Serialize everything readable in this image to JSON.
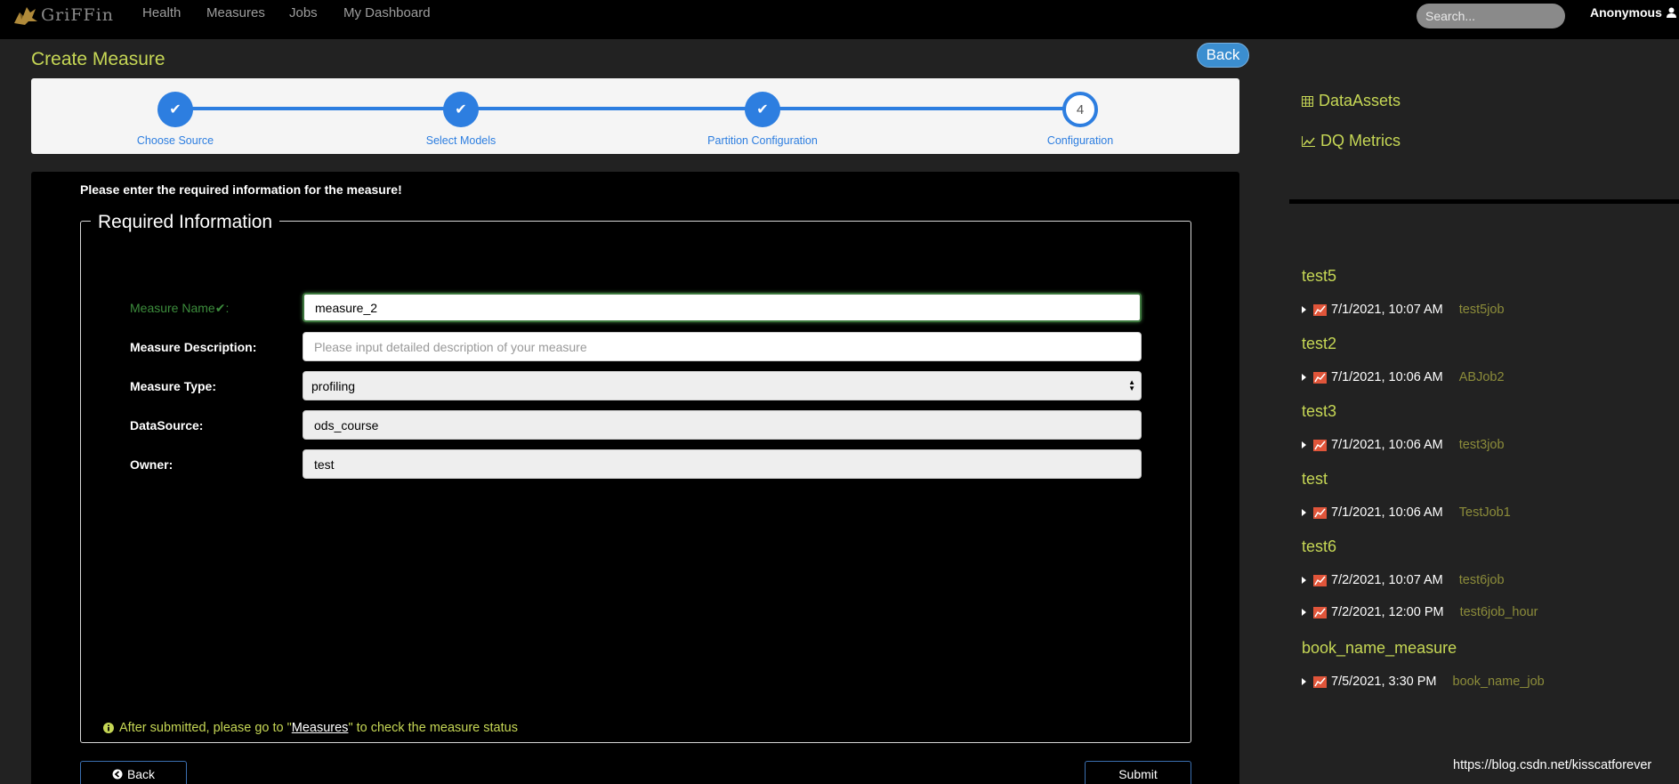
{
  "app": {
    "logo_text": "GriFFin",
    "nav": [
      "Health",
      "Measures",
      "Jobs",
      "My Dashboard"
    ],
    "search_placeholder": "Search...",
    "user": "Anonymous"
  },
  "page": {
    "title": "Create Measure",
    "back_label": "Back"
  },
  "stepper": {
    "steps": [
      {
        "label": "Choose Source",
        "state": "done"
      },
      {
        "label": "Select Models",
        "state": "done"
      },
      {
        "label": "Partition Configuration",
        "state": "done"
      },
      {
        "label": "Configuration",
        "state": "current",
        "number": "4"
      }
    ]
  },
  "form": {
    "intro": "Please enter the required information for the measure!",
    "legend": "Required Information",
    "fields": {
      "name": {
        "label": "Measure Name",
        "suffix": ":",
        "value": "measure_2"
      },
      "description": {
        "label": "Measure Description:",
        "placeholder": "Please input detailed description of your measure",
        "value": ""
      },
      "type": {
        "label": "Measure Type:",
        "value": "profiling"
      },
      "datasource": {
        "label": "DataSource:",
        "value": "ods_course"
      },
      "owner": {
        "label": "Owner:",
        "value": "test"
      }
    },
    "note_before": "After submitted, please go to \"",
    "note_link": "Measures",
    "note_after": "\" to check the measure status",
    "back_button": "Back",
    "submit_button": "Submit"
  },
  "sidebar": {
    "nav": [
      "DataAssets",
      "DQ Metrics"
    ],
    "groups": [
      {
        "name": "test5",
        "rows": [
          {
            "time": "7/1/2021, 10:07 AM",
            "job": "test5job"
          }
        ]
      },
      {
        "name": "test2",
        "rows": [
          {
            "time": "7/1/2021, 10:06 AM",
            "job": "ABJob2"
          }
        ]
      },
      {
        "name": "test3",
        "rows": [
          {
            "time": "7/1/2021, 10:06 AM",
            "job": "test3job"
          }
        ]
      },
      {
        "name": "test",
        "rows": [
          {
            "time": "7/1/2021, 10:06 AM",
            "job": "TestJob1"
          }
        ]
      },
      {
        "name": "test6",
        "rows": [
          {
            "time": "7/2/2021, 10:07 AM",
            "job": "test6job"
          },
          {
            "time": "7/2/2021, 12:00 PM",
            "job": "test6job_hour"
          }
        ]
      },
      {
        "name": "book_name_measure",
        "rows": [
          {
            "time": "7/5/2021, 3:30 PM",
            "job": "book_name_job"
          }
        ]
      }
    ]
  },
  "watermark": "https://blog.csdn.net/kisscatforever",
  "colors": {
    "accent_green": "#c6d755",
    "step_blue": "#2d7ee0",
    "button_blue": "#3b8ed0"
  }
}
